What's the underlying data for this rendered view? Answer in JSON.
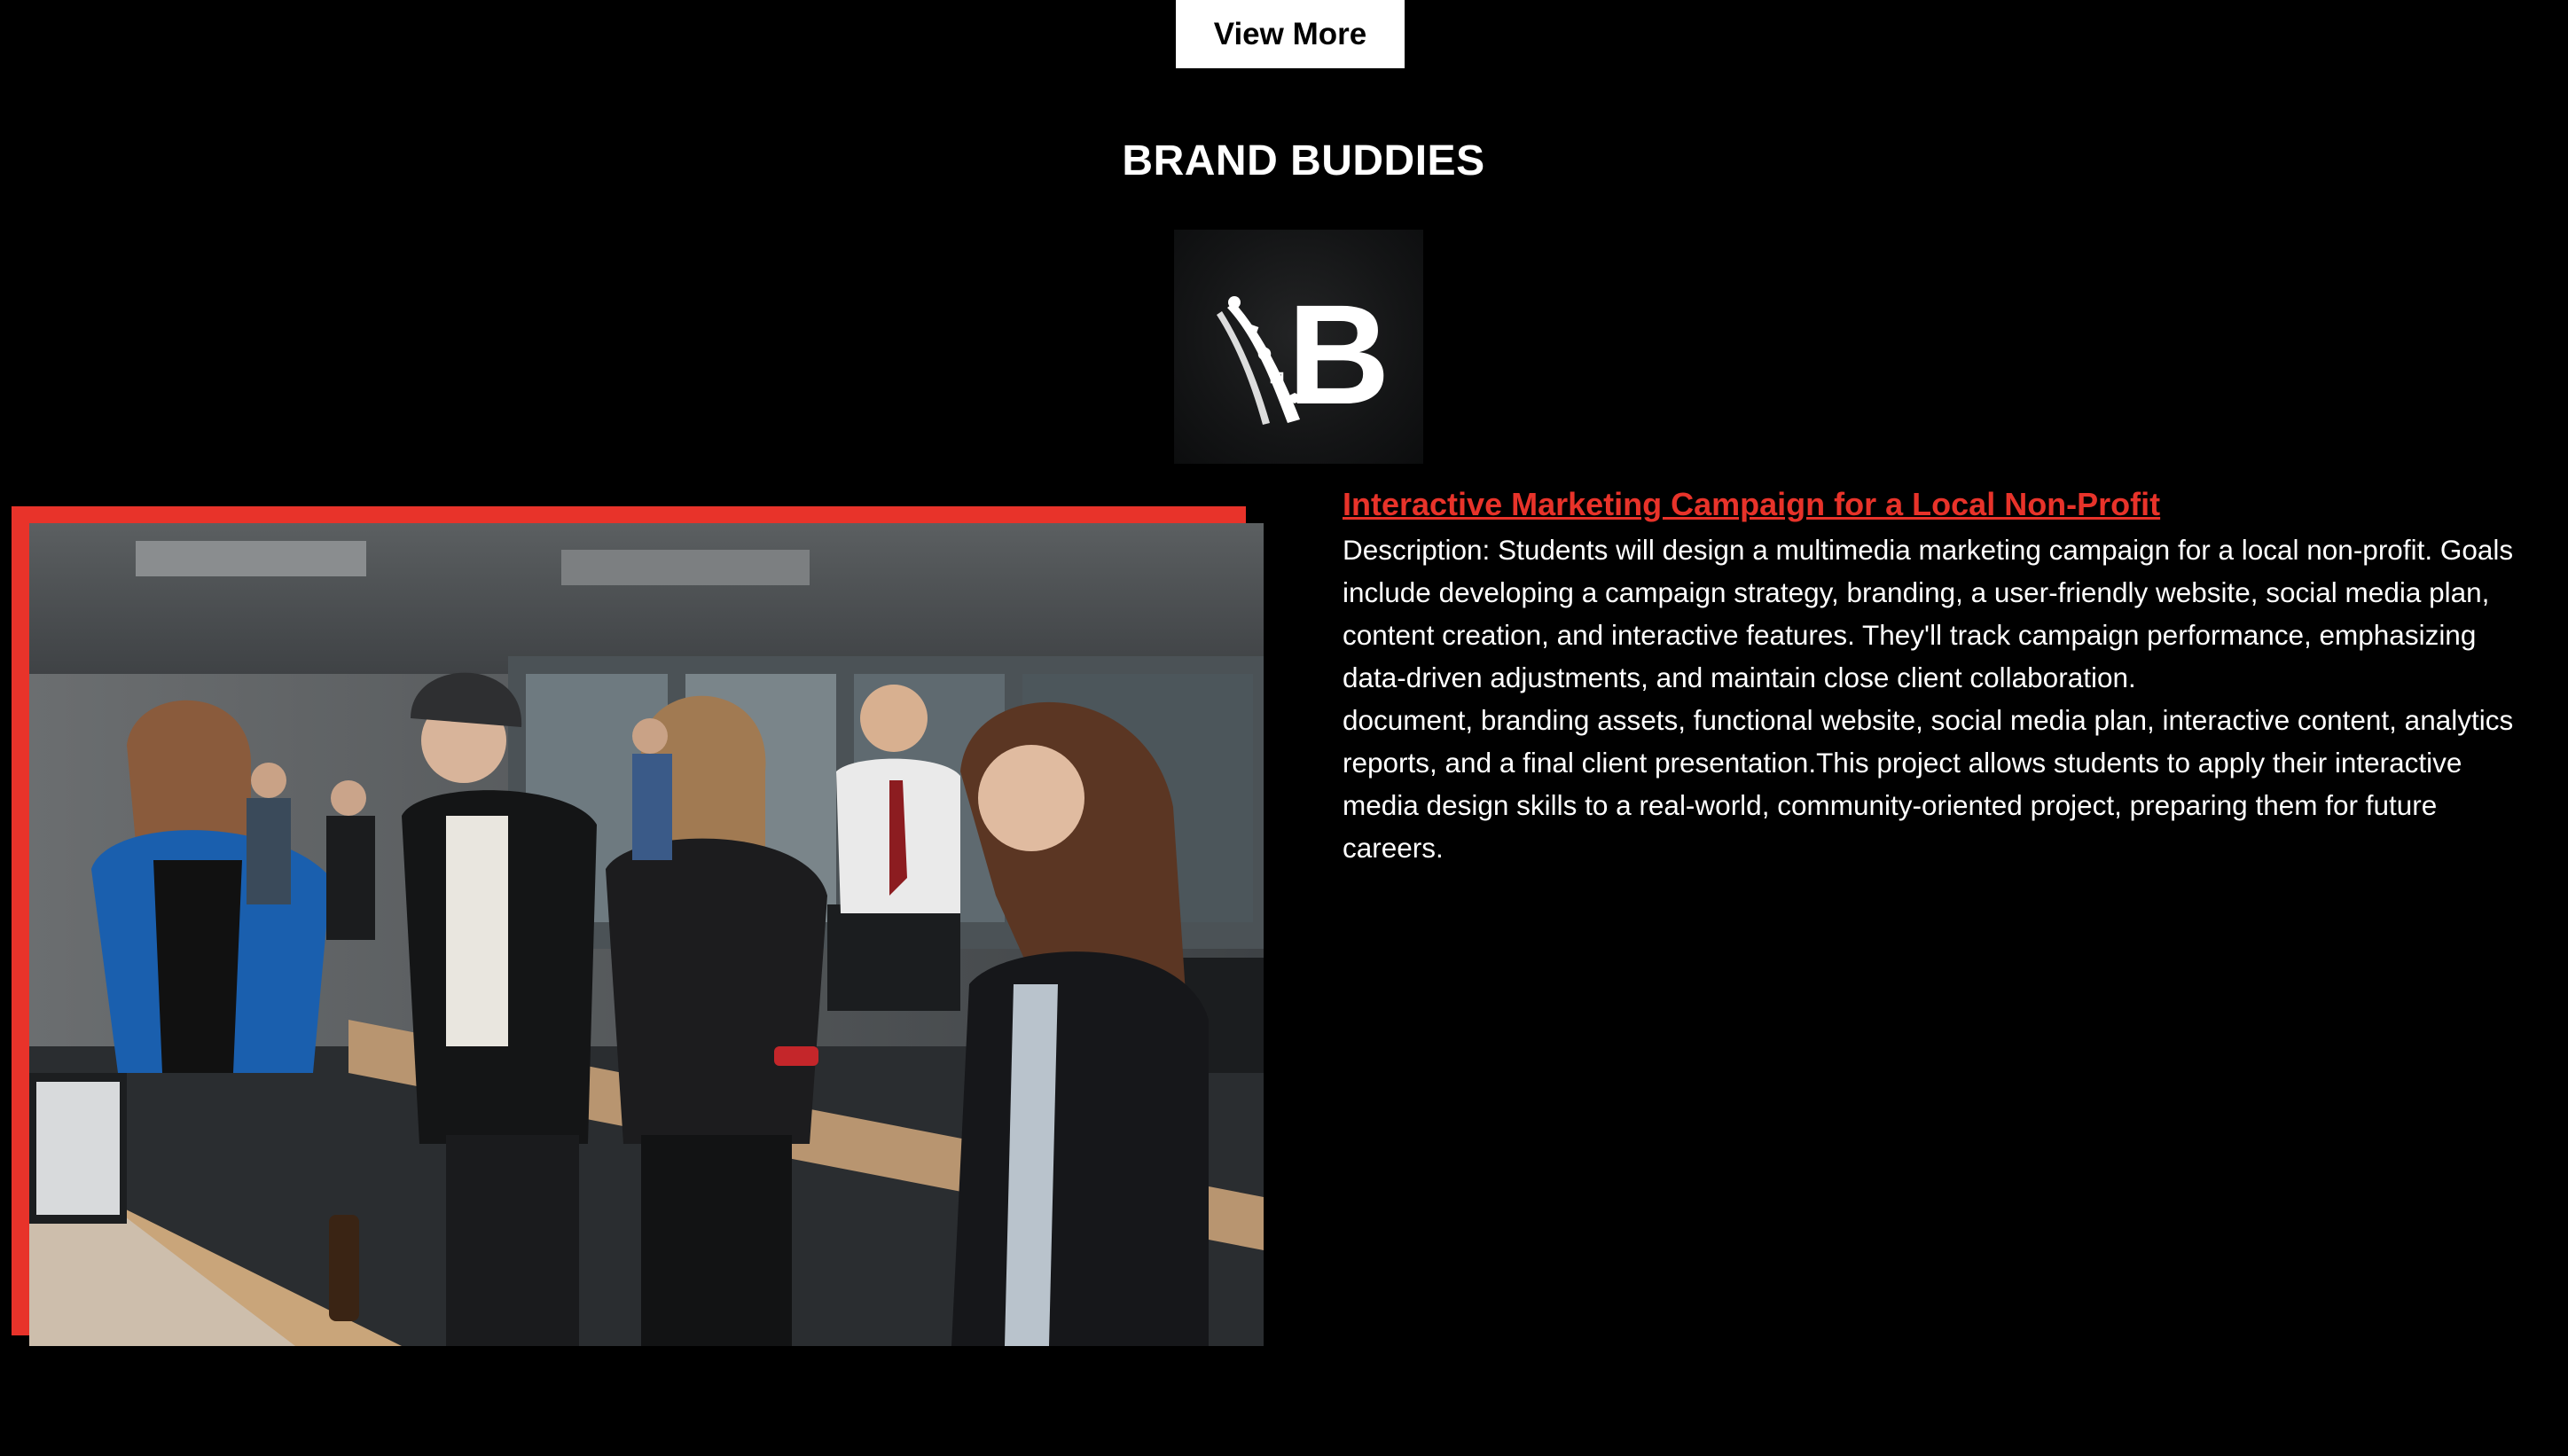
{
  "header": {
    "view_more_label": "View More"
  },
  "section": {
    "title": "BRAND BUDDIES"
  },
  "logo": {
    "letter": "B",
    "icon": "brand-buddies-logo"
  },
  "project": {
    "title": "Interactive Marketing Campaign for a Local Non-Profit",
    "description": "Description: Students will design a multimedia marketing campaign for a local non-profit. Goals include developing a campaign strategy, branding, a user-friendly website, social media plan, content creation, and interactive features. They'll track campaign performance, emphasizing data-driven adjustments, and maintain close client collaboration.",
    "deliverables": "document, branding assets, functional website, social media plan, interactive content, analytics reports, and a final client presentation.This project allows students to apply their interactive media design skills to a real-world, community-oriented project, preparing them for future careers."
  },
  "colors": {
    "accent": "#e8332a",
    "background": "#000000",
    "button_bg": "#ffffff"
  }
}
